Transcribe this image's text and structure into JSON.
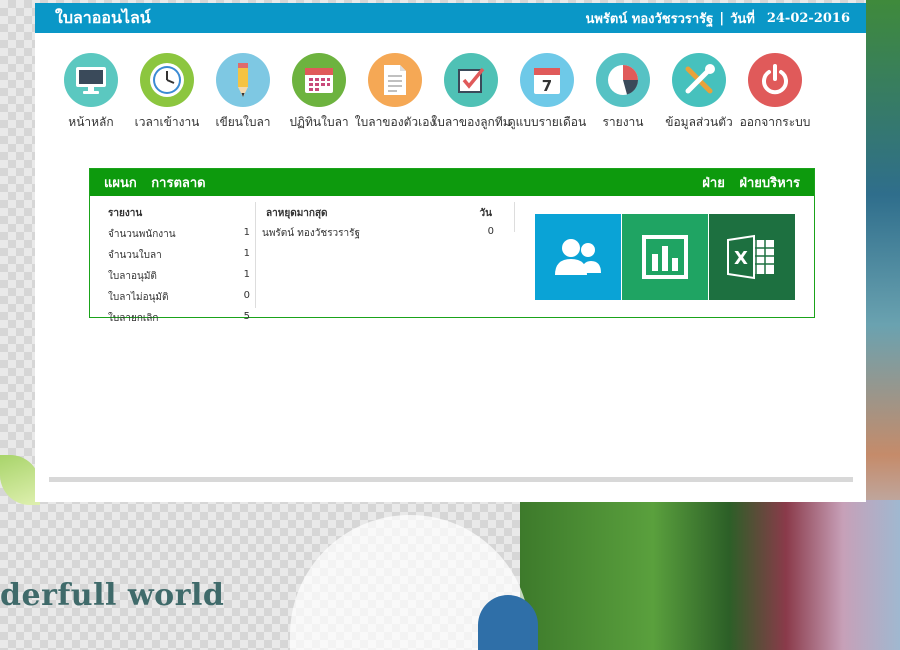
{
  "app": {
    "title": "ใบลาออนไลน์"
  },
  "user": {
    "name": "นพรัตน์ ทองวัชรวรารัฐ",
    "separator": "|",
    "date_label": "วันที่",
    "date": "24-02-2016"
  },
  "menu": [
    {
      "label": "หน้าหลัก",
      "icon": "monitor-icon",
      "color": "#5bc8c0"
    },
    {
      "label": "เวลาเข้างาน",
      "icon": "clock-icon",
      "color": "#8cc63f"
    },
    {
      "label": "เขียนใบลา",
      "icon": "pencil-icon",
      "color": "#7ec8e3"
    },
    {
      "label": "ปฏิทินใบลา",
      "icon": "calendar-grid-icon",
      "color": "#6db33f"
    },
    {
      "label": "ใบลาของตัวเอง",
      "icon": "document-icon",
      "color": "#f5a855"
    },
    {
      "label": "ใบลาของลูกทีม",
      "icon": "checkbox-icon",
      "color": "#4fc1b5"
    },
    {
      "label": "ดูแบบรายเดือน",
      "icon": "calendar-7-icon",
      "color": "#6ec9e8"
    },
    {
      "label": "รายงาน",
      "icon": "pie-chart-icon",
      "color": "#56c2c4"
    },
    {
      "label": "ข้อมูลส่วนตัว",
      "icon": "tools-icon",
      "color": "#46c1bd"
    },
    {
      "label": "ออกจากระบบ",
      "icon": "power-icon",
      "color": "#e05a5a"
    }
  ],
  "department": {
    "label": "แผนก",
    "name": "การตลาด",
    "division_label": "ฝ่าย",
    "division_name": "ฝ่ายบริหาร"
  },
  "report": {
    "title": "รายงาน",
    "rows": [
      {
        "label": "จำนวนพนักงาน",
        "value": "1"
      },
      {
        "label": "จำนวนใบลา",
        "value": "1"
      },
      {
        "label": "ใบลาอนุมัติ",
        "value": "1"
      },
      {
        "label": "ใบลาไม่อนุมัติ",
        "value": "0"
      },
      {
        "label": "ใบลายกเลิก",
        "value": "5"
      }
    ]
  },
  "most_leave": {
    "title": "ลาหยุดมากสุด",
    "unit_label": "วัน",
    "rows": [
      {
        "name": "นพรัตน์ ทองวัชรวรารัฐ",
        "days": "0"
      }
    ]
  },
  "tiles": [
    {
      "icon": "users-icon",
      "color": "#0aa3d6"
    },
    {
      "icon": "bar-chart-icon",
      "color": "#1fa463"
    },
    {
      "icon": "excel-icon",
      "color": "#1d7040"
    }
  ],
  "background": {
    "tagline": "derfull world"
  }
}
